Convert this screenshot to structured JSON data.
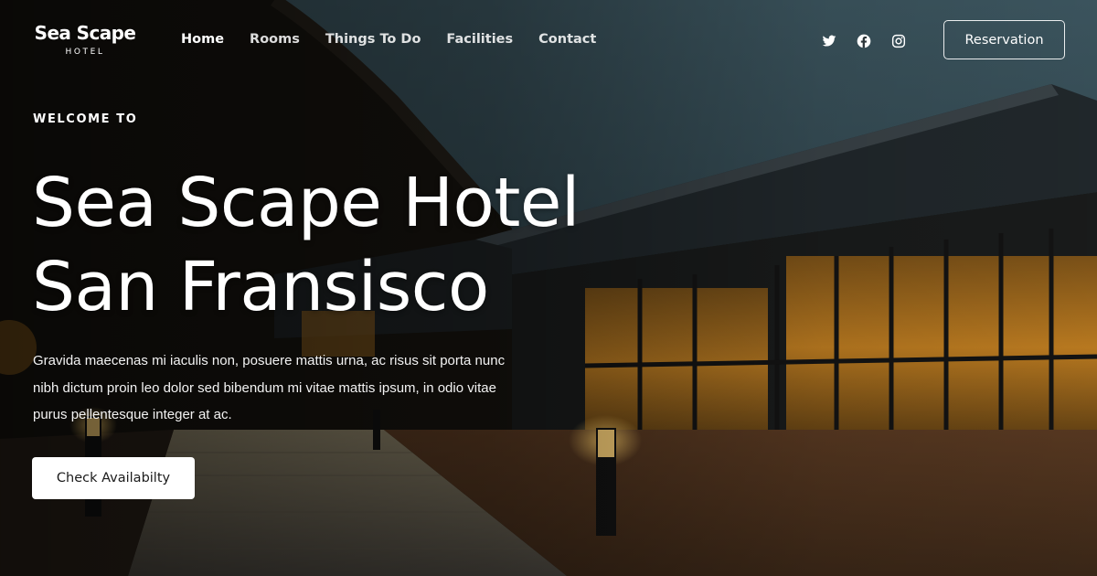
{
  "brand": {
    "name": "Sea Scape",
    "tagline": "HOTEL"
  },
  "nav": {
    "items": [
      {
        "label": "Home",
        "active": true
      },
      {
        "label": "Rooms",
        "active": false
      },
      {
        "label": "Things To Do",
        "active": false
      },
      {
        "label": "Facilities",
        "active": false
      },
      {
        "label": "Contact",
        "active": false
      }
    ]
  },
  "social": {
    "icons": [
      "twitter-icon",
      "facebook-icon",
      "instagram-icon"
    ]
  },
  "header": {
    "reservation_label": "Reservation"
  },
  "hero": {
    "eyebrow": "WELCOME TO",
    "title_line1": "Sea Scape Hotel",
    "title_line2": "San Fransisco",
    "description": "Gravida maecenas mi iaculis non, posuere mattis urna, ac risus sit porta nunc nibh dictum proin leo dolor sed bibendum mi vitae mattis ipsum, in odio vitae purus pellentesque integer at ac.",
    "cta_label": "Check Availabilty"
  },
  "colors": {
    "text": "#ffffff",
    "button_bg": "#ffffff",
    "button_text": "#1b1b1b",
    "window_glow": "#f0a32a"
  }
}
